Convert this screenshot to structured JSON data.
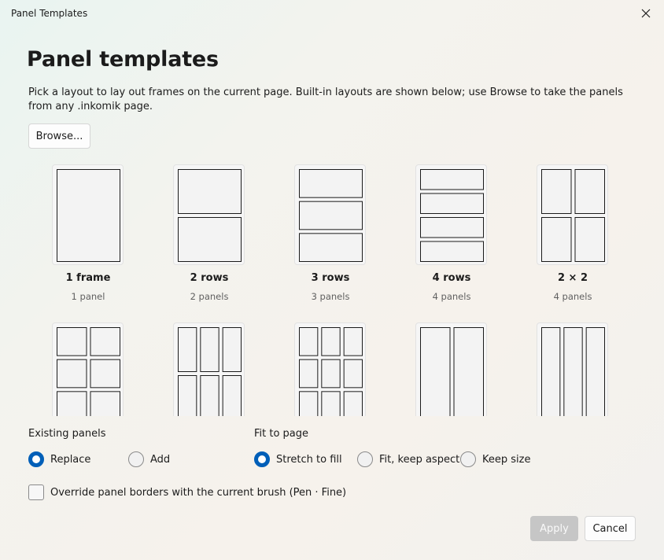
{
  "window": {
    "title": "Panel Templates"
  },
  "header": {
    "title": "Panel templates",
    "description": "Pick a layout to lay out frames on the current page. Built-in layouts are shown below; use Browse to take the panels from any .inkomik page."
  },
  "browse_label": "Browse...",
  "templates": [
    {
      "name": "1 frame",
      "count": "1 panel",
      "rows": 1,
      "cols": 1
    },
    {
      "name": "2 rows",
      "count": "2 panels",
      "rows": 2,
      "cols": 1
    },
    {
      "name": "3 rows",
      "count": "3 panels",
      "rows": 3,
      "cols": 1
    },
    {
      "name": "4 rows",
      "count": "4 panels",
      "rows": 4,
      "cols": 1
    },
    {
      "name": "2 × 2",
      "count": "4 panels",
      "rows": 2,
      "cols": 2
    },
    {
      "rows": 3,
      "cols": 2
    },
    {
      "rows": 2,
      "cols": 3
    },
    {
      "rows": 3,
      "cols": 3
    },
    {
      "rows": 1,
      "cols": 2
    },
    {
      "rows": 1,
      "cols": 3
    }
  ],
  "existing_panels": {
    "label": "Existing panels",
    "options": [
      "Replace",
      "Add"
    ],
    "selected": "Replace"
  },
  "fit_to_page": {
    "label": "Fit to page",
    "options": [
      "Stretch to fill",
      "Fit, keep aspect",
      "Keep size"
    ],
    "selected": "Stretch to fill"
  },
  "override_borders": {
    "label": "Override panel borders with the current brush (Pen · Fine)",
    "checked": false
  },
  "footer": {
    "apply_label": "Apply",
    "cancel_label": "Cancel"
  },
  "colors": {
    "accent": "#005fb8",
    "disabled_button": "#c6c6c6"
  }
}
